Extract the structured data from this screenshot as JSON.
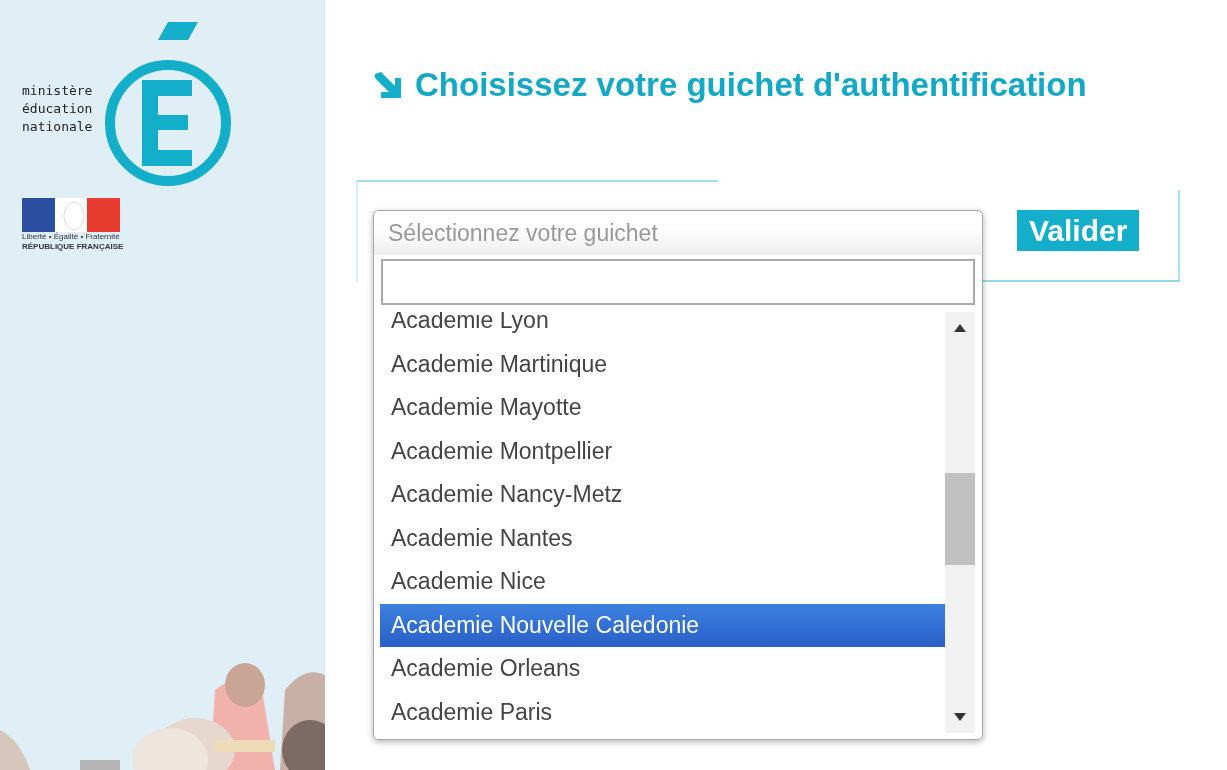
{
  "logo": {
    "lines": [
      "ministère",
      "éducation",
      "nationale"
    ],
    "motto": "Liberté • Égalité • Fraternité",
    "republic": "RÉPUBLIQUE FRANÇAISE"
  },
  "heading": "Choisissez votre guichet d'authentification",
  "select": {
    "placeholder": "Sélectionnez votre guichet",
    "expanded": true,
    "options": [
      {
        "label": "Academie Lyon",
        "selected": false
      },
      {
        "label": "Academie Martinique",
        "selected": false
      },
      {
        "label": "Academie Mayotte",
        "selected": false
      },
      {
        "label": "Academie Montpellier",
        "selected": false
      },
      {
        "label": "Academie Nancy-Metz",
        "selected": false
      },
      {
        "label": "Academie Nantes",
        "selected": false
      },
      {
        "label": "Academie Nice",
        "selected": false
      },
      {
        "label": "Academie Nouvelle Caledonie",
        "selected": true
      },
      {
        "label": "Academie Orleans",
        "selected": false
      },
      {
        "label": "Academie Paris",
        "selected": false
      }
    ]
  },
  "submit": "Valider"
}
